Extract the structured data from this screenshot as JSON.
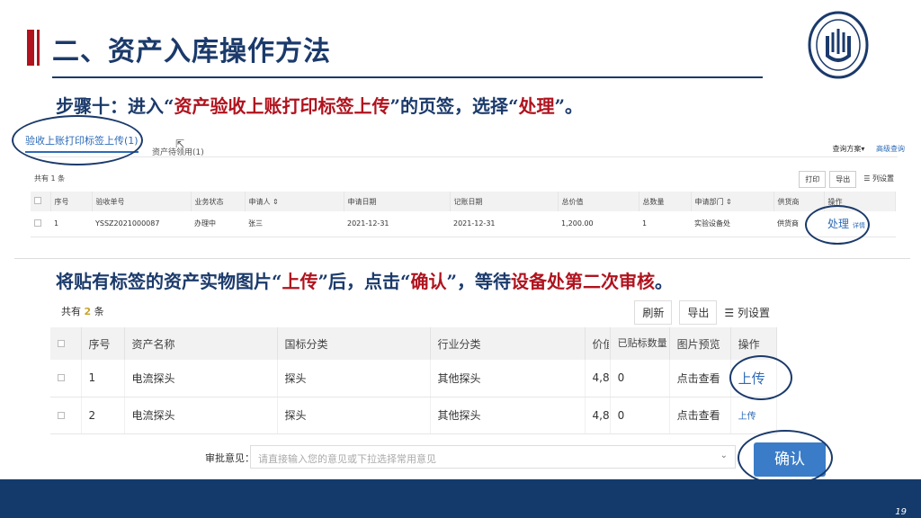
{
  "slide": {
    "title": "二、资产入库操作方法",
    "logo_text": "SHANGHAI UNIVERSITY",
    "step_parts": [
      "步骤十：进入“",
      "资产验收上账打印标签上传",
      "”的页签，选择“",
      "处理",
      "”。"
    ],
    "step2_parts": [
      "将贴有标签的资产实物图片“",
      "上传",
      "”后，点击“",
      "确认",
      "”，等待",
      "设备处第二次审核",
      "。"
    ],
    "page_number": "19"
  },
  "screen1": {
    "tab_active": "验收上账打印标签上传(1)",
    "tab2": "资产待领用(1)",
    "links": [
      "查询方案▾",
      "高级查询"
    ],
    "count": "共有 1 条",
    "tools": [
      "打印",
      "导出",
      "☰ 列设置"
    ],
    "headers": [
      "",
      "序号",
      "验收单号",
      "业务状态",
      "申请人 ⇕",
      "申请日期",
      "记账日期",
      "总价值",
      "总数量",
      "申请部门 ⇕",
      "供货商",
      "操作"
    ],
    "row": {
      "no": "1",
      "order": "YSSZ2021000087",
      "status": "办理中",
      "applicant": "张三",
      "apply_date": "2021-12-31",
      "post_date": "2021-12-31",
      "total_value": "1,200.00",
      "quantity": "1",
      "department": "实验设备处",
      "supplier": "供货商",
      "action": "处理",
      "detail": "详情"
    }
  },
  "screen2": {
    "count_prefix": "共有",
    "count_num": "2",
    "count_suffix": "条",
    "tools": [
      "刷新",
      "导出",
      "☰ 列设置"
    ],
    "headers": [
      "",
      "序号",
      "资产名称",
      "国标分类",
      "行业分类",
      "价值",
      "已贴标数量",
      "图片预览",
      "操作"
    ],
    "rows": [
      {
        "no": "1",
        "name": "电流探头",
        "gb": "探头",
        "industry": "其他探头",
        "value": "4,8",
        "labeled": "0",
        "preview": "点击查看",
        "action": "上传"
      },
      {
        "no": "2",
        "name": "电流探头",
        "gb": "探头",
        "industry": "其他探头",
        "value": "4,8",
        "labeled": "0",
        "preview": "点击查看",
        "action": "上传"
      }
    ],
    "review_label": "审批意见：",
    "review_placeholder": "请直接输入您的意见或下拉选择常用意见",
    "confirm": "确认"
  },
  "colors": {
    "navy": "#1b3a6b",
    "red": "#b0131e",
    "link": "#2d6bb7",
    "button": "#3a7cc8"
  }
}
